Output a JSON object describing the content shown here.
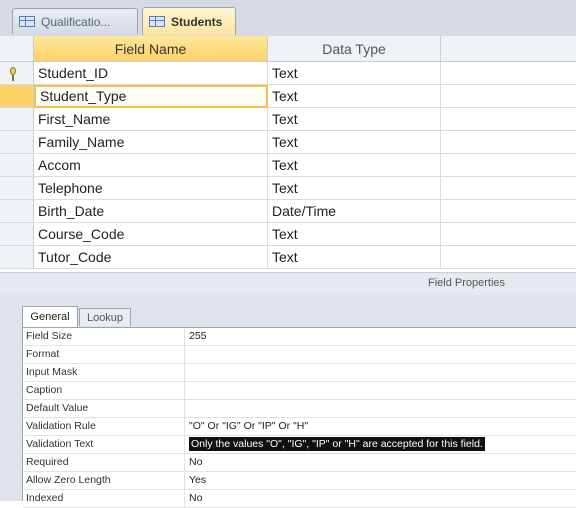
{
  "tabs": [
    {
      "label": "Qualificatio...",
      "active": false
    },
    {
      "label": "Students",
      "active": true
    }
  ],
  "grid": {
    "headers": {
      "field_name": "Field Name",
      "data_type": "Data Type"
    },
    "rows": [
      {
        "field": "Student_ID",
        "type": "Text",
        "primary_key": true
      },
      {
        "field": "Student_Type",
        "type": "Text",
        "current": true
      },
      {
        "field": "First_Name",
        "type": "Text"
      },
      {
        "field": "Family_Name",
        "type": "Text"
      },
      {
        "field": "Accom",
        "type": "Text"
      },
      {
        "field": "Telephone",
        "type": "Text"
      },
      {
        "field": "Birth_Date",
        "type": "Date/Time"
      },
      {
        "field": "Course_Code",
        "type": "Text"
      },
      {
        "field": "Tutor_Code",
        "type": "Text"
      }
    ]
  },
  "field_properties_label": "Field Properties",
  "property_tabs": {
    "general": "General",
    "lookup": "Lookup"
  },
  "properties": [
    {
      "label": "Field Size",
      "value": "255"
    },
    {
      "label": "Format",
      "value": ""
    },
    {
      "label": "Input Mask",
      "value": ""
    },
    {
      "label": "Caption",
      "value": ""
    },
    {
      "label": "Default Value",
      "value": ""
    },
    {
      "label": "Validation Rule",
      "value": "\"O\" Or \"IG\" Or \"IP\" Or \"H\""
    },
    {
      "label": "Validation Text",
      "value": "Only the values \"O\", \"IG\", \"IP\" or \"H\" are accepted for this field.",
      "highlighted": true
    },
    {
      "label": "Required",
      "value": "No"
    },
    {
      "label": "Allow Zero Length",
      "value": "Yes"
    },
    {
      "label": "Indexed",
      "value": "No"
    }
  ],
  "colors": {
    "header_accent": "#fdd267",
    "selection_bar": "#f3c24c"
  }
}
